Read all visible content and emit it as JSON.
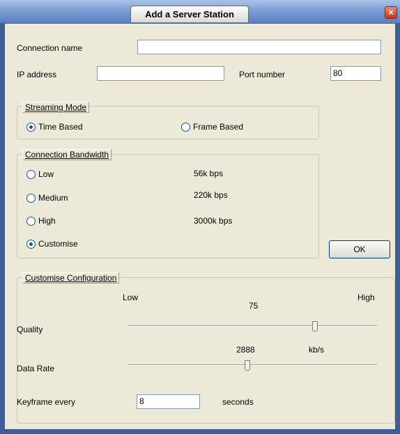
{
  "window": {
    "title": "Add a Server Station",
    "close_glyph": "×"
  },
  "form": {
    "connection_name_label": "Connection name",
    "connection_name_value": "",
    "ip_label": "IP address",
    "ip_value": "",
    "port_label": "Port number",
    "port_value": "80"
  },
  "streaming_mode": {
    "legend": "Streaming Mode",
    "options": [
      {
        "label": "Time Based",
        "selected": true
      },
      {
        "label": "Frame Based",
        "selected": false
      }
    ]
  },
  "bandwidth": {
    "legend": "Connection Bandwidth",
    "options": [
      {
        "label": "Low",
        "rate": "56k bps",
        "selected": false
      },
      {
        "label": "Medium",
        "rate": "220k bps",
        "selected": false
      },
      {
        "label": "High",
        "rate": "3000k bps",
        "selected": false
      },
      {
        "label": "Customise",
        "rate": "",
        "selected": true
      }
    ]
  },
  "ok_label": "OK",
  "customise": {
    "legend": "Customise Configuration",
    "low_label": "Low",
    "high_label": "High",
    "quality_label": "Quality",
    "quality_value": "75",
    "quality_fraction": 0.75,
    "data_rate_label": "Data Rate",
    "data_rate_value": "2888",
    "data_rate_unit": "kb/s",
    "data_rate_fraction": 0.48,
    "keyframe_label": "Keyframe every",
    "keyframe_value": "8",
    "keyframe_unit": "seconds"
  }
}
